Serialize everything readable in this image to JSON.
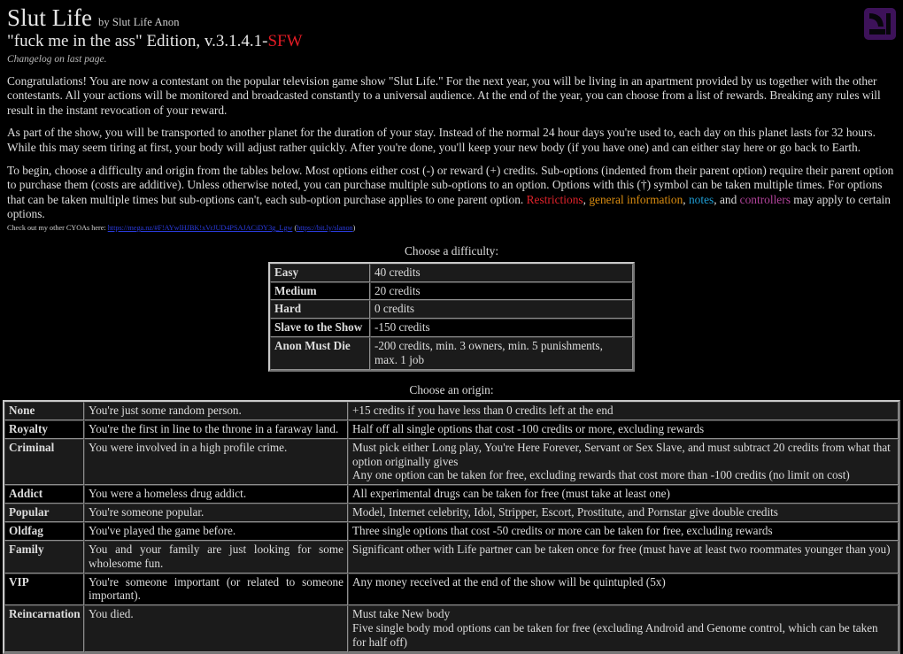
{
  "header": {
    "title": "Slut Life",
    "byline": "by Slut Life Anon",
    "edition_main": "\"fuck me in the ass\" Edition, v.3.1.4.1-",
    "edition_tag": "SFW",
    "changelog": "Changelog on last page.",
    "logo_name": "slut-life-logo",
    "logo_color": "#3d1259"
  },
  "intro": {
    "p1": "Congratulations! You are now a contestant on the popular television game show \"Slut Life.\" For the next year, you will be living in an apartment provided by us together with the other contestants. All your actions will be monitored and broadcasted constantly to a universal audience. At the end of the year, you can choose from a list of rewards. Breaking any rules will result in the instant revocation of your reward.",
    "p2": "As part of the show, you will be transported to another planet for the duration of your stay. Instead of the normal 24 hour days you're used to, each day on this planet lasts for 32 hours. While this may seem tiring at first, your body will adjust rather quickly. After you're done, you'll keep your new body (if you have one) and can either stay here or go back to Earth.",
    "p3_a": "To begin, choose a difficulty and origin from the tables below. Most options either cost (-) or reward (+) credits. Sub-options (indented from their parent option) require their parent option to purchase them (costs are additive). Unless otherwise noted, you can purchase multiple sub-options to an option. Options with this (†) symbol can be taken multiple times. For options that can be taken multiple times but sub-options can't, each sub-option purchase applies to one parent option. ",
    "p3_restrictions": "Restrictions",
    "p3_sep1": ", ",
    "p3_geninfo": "general information",
    "p3_sep2": ", ",
    "p3_notes": "notes",
    "p3_sep3": ", and ",
    "p3_controllers": "controllers",
    "p3_end": " may apply to certain options.",
    "colors": {
      "restrictions": "#e0232b",
      "general_information": "#d98c10",
      "notes": "#1f9fd6",
      "controllers": "#b3449c",
      "sfw": "#e01b24",
      "link": "#2a3bdd"
    }
  },
  "cyoa": {
    "prefix": "Check out my other CYOAs here: ",
    "link_main": "https://mega.nz/#F!AYwlHJBK!xVrJUD4PSAJACiDY3g_Lgw",
    "paren_open": " (",
    "link_short": "https://bit.ly/slanon",
    "paren_close": ")"
  },
  "difficulty": {
    "caption": "Choose a difficulty:",
    "rows": [
      {
        "name": "Easy",
        "effect": "40 credits"
      },
      {
        "name": "Medium",
        "effect": "20 credits"
      },
      {
        "name": "Hard",
        "effect": "0 credits"
      },
      {
        "name": "Slave to the Show",
        "effect": "-150 credits"
      },
      {
        "name": "Anon Must Die",
        "effect": "-200 credits, min. 3 owners, min. 5 punishments, max. 1 job"
      }
    ]
  },
  "origin": {
    "caption": "Choose an origin:",
    "rows": [
      {
        "name": "None",
        "description": "You're just some random person.",
        "effect_1": "+15 credits if you have less than 0 credits left at the end",
        "effect_2": ""
      },
      {
        "name": "Royalty",
        "description": "You're the first in line to the throne in a faraway land.",
        "effect_1": "Half off all single options that cost -100 credits or more, excluding rewards",
        "effect_2": ""
      },
      {
        "name": "Criminal",
        "description": "You were involved in a high profile crime.",
        "effect_1": "Must pick either Long play, You're Here Forever, Servant or Sex Slave, and must subtract 20 credits from what that option originally gives",
        "effect_2": "Any one option can be taken for free, excluding rewards that cost more than -100 credits (no limit on cost)"
      },
      {
        "name": "Addict",
        "description": "You were a homeless drug addict.",
        "effect_1": "All experimental drugs can be taken for free (must take at least one)",
        "effect_2": ""
      },
      {
        "name": "Popular",
        "description": "You're someone popular.",
        "effect_1": "Model, Internet celebrity, Idol, Stripper, Escort, Prostitute, and Pornstar give double credits",
        "effect_2": ""
      },
      {
        "name": "Oldfag",
        "description": "You've played the game before.",
        "effect_1": "Three single options that cost -50 credits or more can be taken for free, excluding rewards",
        "effect_2": ""
      },
      {
        "name": "Family",
        "description": "You and your family are just looking for some wholesome fun.",
        "effect_1": "Significant other with Life partner can be taken once for free (must have at least two roommates younger than you)",
        "effect_2": ""
      },
      {
        "name": "VIP",
        "description": "You're someone important (or related to someone important).",
        "effect_1": "Any money received at the end of the show will be quintupled (5x)",
        "effect_2": ""
      },
      {
        "name": "Reincarnation",
        "description": "You died.",
        "effect_1": "Must take New body",
        "effect_2": "Five single body mod options can be taken for free (excluding Android and Genome control, which can be taken for half off)"
      }
    ]
  }
}
